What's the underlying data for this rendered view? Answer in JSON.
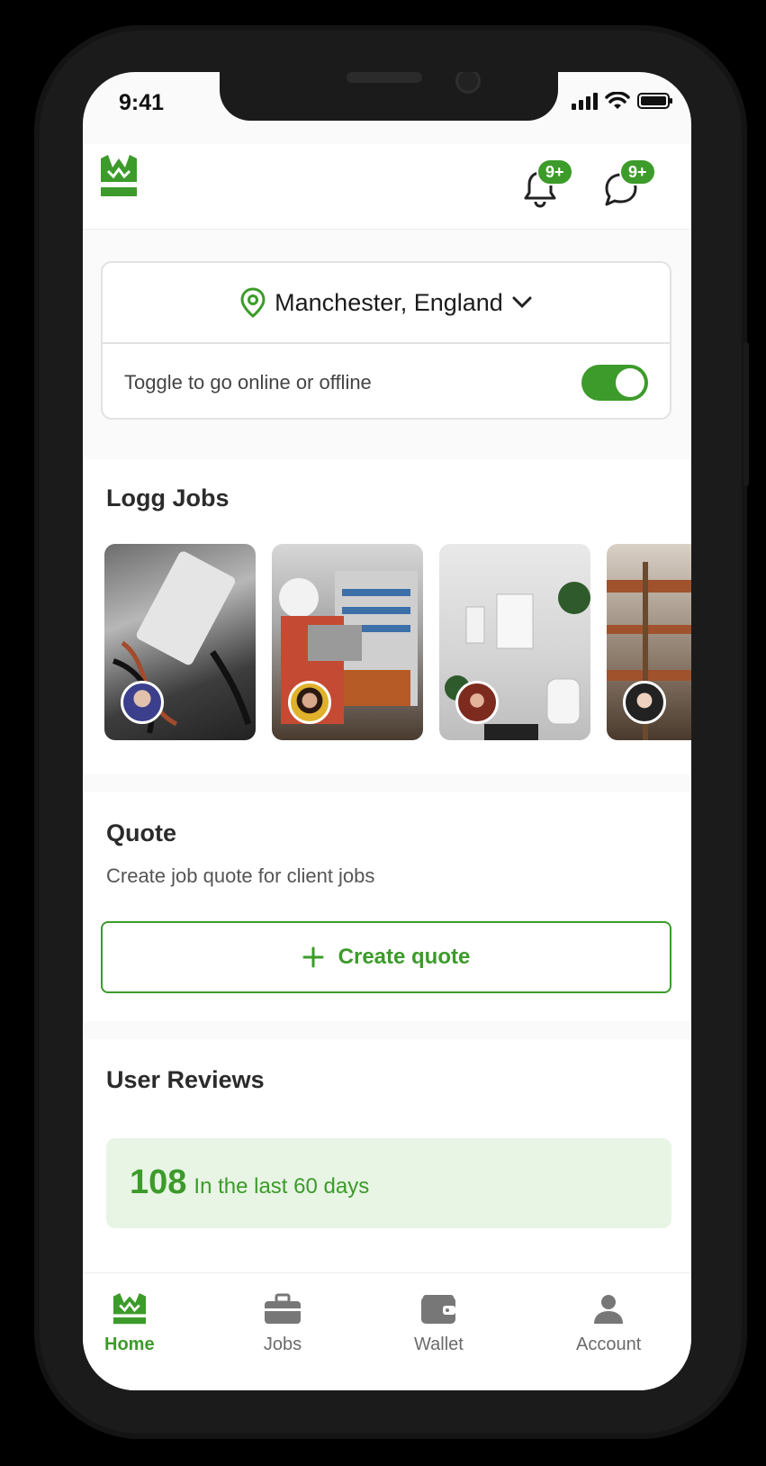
{
  "status_bar": {
    "time": "9:41"
  },
  "header": {
    "notifications_badge": "9+",
    "messages_badge": "9+"
  },
  "location_card": {
    "location": "Manchester, England",
    "toggle_label": "Toggle to go online or offline",
    "online": true
  },
  "logg_jobs": {
    "title": "Logg Jobs",
    "jobs": [
      {
        "image_icon": "electrical-install-photo",
        "avatar_icon": "worker-avatar"
      },
      {
        "image_icon": "electrician-panel-photo",
        "avatar_icon": "worker-avatar"
      },
      {
        "image_icon": "bathroom-photo",
        "avatar_icon": "worker-avatar"
      },
      {
        "image_icon": "scaffolding-photo",
        "avatar_icon": "worker-avatar"
      }
    ]
  },
  "quote": {
    "title": "Quote",
    "description": "Create job quote for client jobs",
    "button_label": "Create quote"
  },
  "reviews": {
    "title": "User Reviews",
    "count": "108",
    "period": "In the last 60 days"
  },
  "bottom_nav": {
    "items": [
      {
        "label": "Home",
        "icon": "home-logo-icon",
        "active": true
      },
      {
        "label": "Jobs",
        "icon": "briefcase-icon",
        "active": false
      },
      {
        "label": "Wallet",
        "icon": "wallet-icon",
        "active": false
      },
      {
        "label": "Account",
        "icon": "person-icon",
        "active": false
      }
    ]
  },
  "colors": {
    "accent": "#3c9b2a",
    "accent_light": "#e8f5e5"
  }
}
